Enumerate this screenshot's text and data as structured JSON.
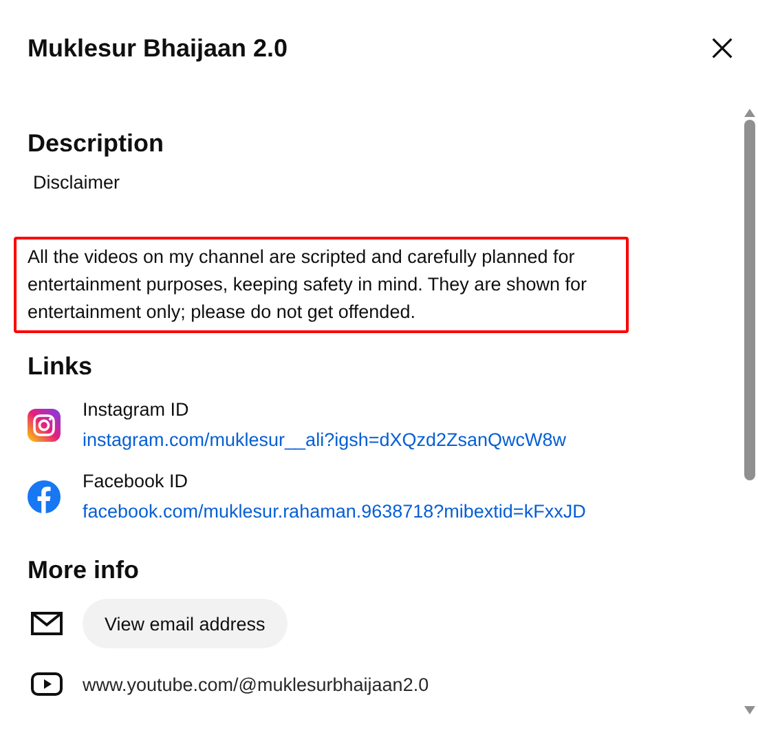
{
  "dialog": {
    "title": "Muklesur Bhaijaan 2.0"
  },
  "description": {
    "heading": "Description",
    "lines": [
      {
        "text": "Disclaimer",
        "highlighted": false
      },
      {
        "text": "All the videos on my channel are scripted and carefully planned for entertainment purposes, keeping safety in mind. They are shown for entertainment only; please do not get offended.",
        "highlighted": true
      }
    ]
  },
  "links": {
    "heading": "Links",
    "items": [
      {
        "kind": "instagram",
        "label": "Instagram ID",
        "url": "instagram.com/muklesur__ali?igsh=dXQzd2ZsanQwcW8w"
      },
      {
        "kind": "facebook",
        "label": "Facebook ID",
        "url": "facebook.com/muklesur.rahaman.9638718?mibextid=kFxxJD"
      }
    ]
  },
  "more_info": {
    "heading": "More info",
    "items": [
      {
        "kind": "email",
        "text": "View email address"
      },
      {
        "kind": "channel",
        "text": "www.youtube.com/@muklesurbhaijaan2.0"
      }
    ]
  }
}
